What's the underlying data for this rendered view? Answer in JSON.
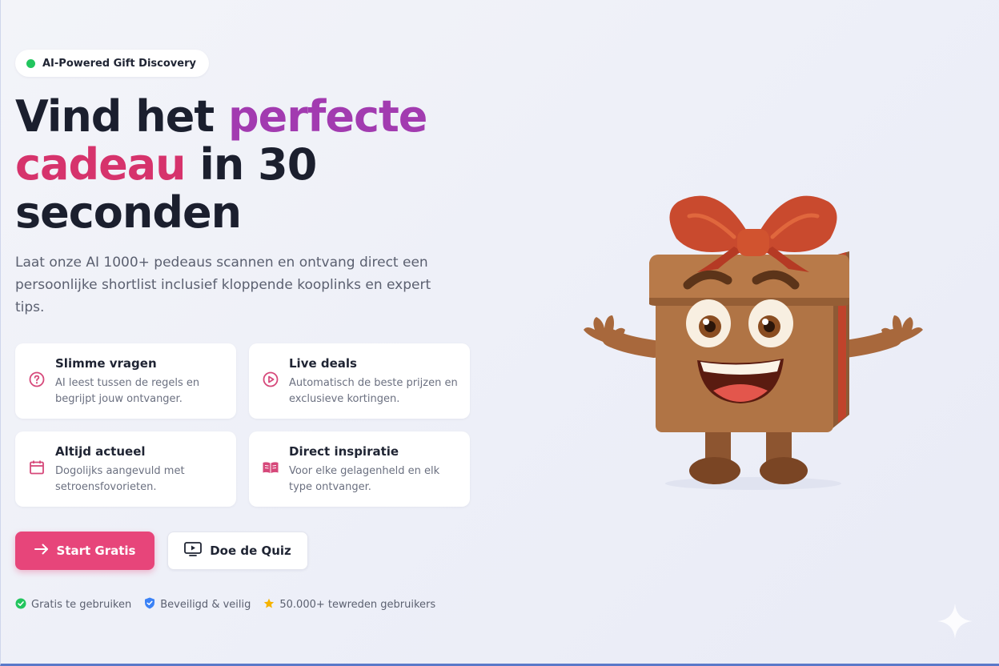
{
  "hero": {
    "badge": "AI-Powered Gift Discovery",
    "headline": {
      "part1": "Vind het ",
      "part2": "perfecte",
      "part3": "cadeau",
      "part4": " in 30",
      "part5": "seconden"
    },
    "subtitle": "Laat onze AI 1000+ pedeaus scannen en ontvang direct een persoonlijke shortlist inclusief kloppende kooplinks en expert tips."
  },
  "features": [
    {
      "title": "Slimme vragen",
      "desc": "AI leest tussen de regels en begrijpt jouw ontvanger.",
      "icon": "question-circle-icon"
    },
    {
      "title": "Live deals",
      "desc": "Automatisch de beste prijzen en exclusieve kortingen.",
      "icon": "play-circle-icon"
    },
    {
      "title": "Altijd actueel",
      "desc": "Dogolijks aangevuld met setroensfovorieten.",
      "icon": "calendar-icon"
    },
    {
      "title": "Direct inspiratie",
      "desc": "Voor elke gelagenheld en elk type ontvanger.",
      "icon": "book-open-icon"
    }
  ],
  "buttons": {
    "primary": "Start Gratis",
    "secondary": "Doe de Quiz"
  },
  "trust": [
    {
      "label": "Gratis te gebruiken",
      "icon": "check-circle-icon",
      "color": "#22c55e"
    },
    {
      "label": "Beveiligd & veilig",
      "icon": "shield-check-icon",
      "color": "#3b82f6"
    },
    {
      "label": "50.000+ tewreden gebruikers",
      "icon": "star-icon",
      "color": "#f5b301"
    }
  ],
  "colors": {
    "accent_pink": "#e7457a",
    "headline_purple": "#a23bb0",
    "headline_pink": "#d6336c",
    "feature_icon": "#d6487a"
  }
}
